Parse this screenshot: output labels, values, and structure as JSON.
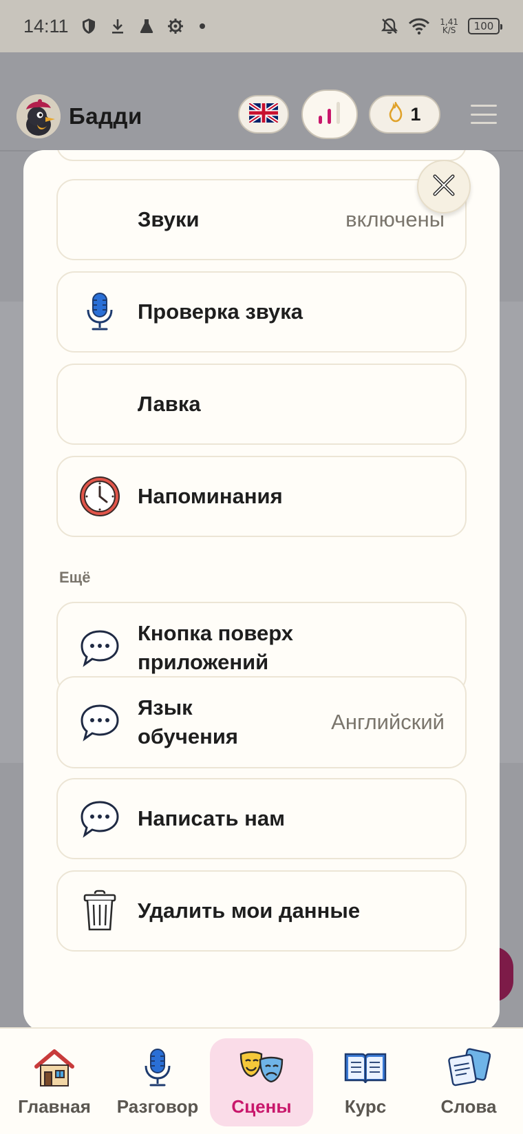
{
  "status_bar": {
    "time": "14:11",
    "net_speed_top": "1,41",
    "net_speed_bottom": "K/S",
    "battery": "100",
    "icons": [
      "shield-icon",
      "download-icon",
      "flask-icon",
      "gear-icon",
      "dot-icon",
      "bell-off-icon",
      "wifi-icon"
    ]
  },
  "header": {
    "app_name": "Бадди",
    "streak_count": "1",
    "icons": [
      "bird-avatar-icon",
      "uk-flag-icon",
      "level-bars-icon",
      "flame-icon",
      "hamburger-menu-icon"
    ]
  },
  "settings": {
    "items": [
      {
        "label": "Звуки",
        "value": "включены",
        "icon": ""
      },
      {
        "label": "Проверка звука",
        "value": "",
        "icon": "microphone-icon"
      },
      {
        "label": "Лавка",
        "value": "",
        "icon": ""
      },
      {
        "label": "Напоминания",
        "value": "",
        "icon": "clock-icon"
      }
    ],
    "more_section_title": "Ещё",
    "more_items": [
      {
        "label_line1": "Кнопка поверх",
        "label_line2": "приложений",
        "value": "",
        "icon": "chat-bubble-icon"
      },
      {
        "label_line1": "Язык",
        "label_line2": "обучения",
        "value": "Английский",
        "icon": "chat-bubble-icon"
      },
      {
        "label_line1": "Написать нам",
        "label_line2": "",
        "value": "",
        "icon": "chat-bubble-icon"
      },
      {
        "label_line1": "Удалить мои данные",
        "label_line2": "",
        "value": "",
        "icon": "trash-icon"
      }
    ]
  },
  "bottom_nav": {
    "items": [
      {
        "label": "Главная",
        "icon": "house-icon"
      },
      {
        "label": "Разговор",
        "icon": "microphone-icon"
      },
      {
        "label": "Сцены",
        "icon": "theater-masks-icon",
        "active": true
      },
      {
        "label": "Курс",
        "icon": "open-book-icon"
      },
      {
        "label": "Слова",
        "icon": "flashcards-icon"
      }
    ]
  },
  "colors": {
    "accent": "#c8176b",
    "active_tab_bg": "#fadce8",
    "card_border": "#ece5d5",
    "sheet_bg": "#fffdf8",
    "overlay": "#9a9ba0"
  }
}
